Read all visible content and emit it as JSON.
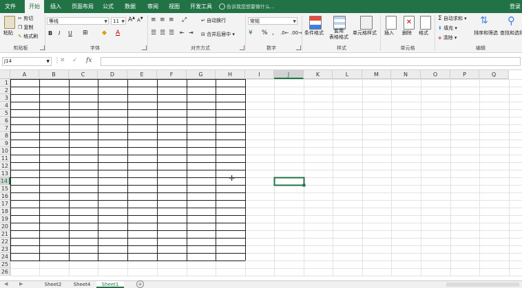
{
  "menu": {
    "tabs": [
      {
        "label": "文件",
        "active": false
      },
      {
        "label": "开始",
        "active": true
      },
      {
        "label": "插入",
        "active": false
      },
      {
        "label": "页面布局",
        "active": false
      },
      {
        "label": "公式",
        "active": false
      },
      {
        "label": "数据",
        "active": false
      },
      {
        "label": "审阅",
        "active": false
      },
      {
        "label": "视图",
        "active": false
      },
      {
        "label": "开发工具",
        "active": false
      }
    ],
    "search_placeholder": "告诉我您想要做什么...",
    "login": "登录"
  },
  "ribbon": {
    "clipboard": {
      "paste": "粘贴",
      "cut": "剪切",
      "copy": "复制",
      "format_painter": "格式刷",
      "label": "剪贴板"
    },
    "font": {
      "name": "等线",
      "size": "11",
      "bold": "B",
      "italic": "I",
      "underline": "U",
      "grow": "A",
      "shrink": "A",
      "label": "字体"
    },
    "alignment": {
      "wrap": "自动换行",
      "merge": "合并后居中",
      "label": "对齐方式"
    },
    "number": {
      "format": "常规",
      "percent": "%",
      "comma": ",",
      "label": "数字"
    },
    "styles": {
      "conditional": "条件格式",
      "table": "套用\n表格格式",
      "cell_styles": "单元格样式",
      "label": "样式"
    },
    "cells": {
      "insert": "插入",
      "delete": "删除",
      "format": "格式",
      "label": "单元格"
    },
    "editing": {
      "autosum": "自动求和",
      "fill": "填充",
      "clear": "清除",
      "sort": "排序和筛选",
      "find": "查找和选择",
      "label": "编辑"
    }
  },
  "formula_bar": {
    "name_box": "J14",
    "fx": "fx",
    "value": ""
  },
  "sheet": {
    "columns": [
      "A",
      "B",
      "C",
      "D",
      "E",
      "F",
      "G",
      "H",
      "I",
      "J",
      "K",
      "L",
      "M",
      "N",
      "O",
      "P",
      "Q"
    ],
    "rows": [
      "1",
      "2",
      "3",
      "4",
      "5",
      "6",
      "7",
      "8",
      "9",
      "10",
      "11",
      "12",
      "13",
      "14",
      "15",
      "16",
      "17",
      "18",
      "19",
      "20",
      "21",
      "22",
      "23",
      "24",
      "25",
      "26"
    ],
    "selected_cell": "J14",
    "bordered_range": "A1:H24"
  },
  "sheet_tabs": [
    {
      "label": "Sheet2",
      "active": false
    },
    {
      "label": "Sheet4",
      "active": false
    },
    {
      "label": "Sheet1",
      "active": true
    }
  ]
}
